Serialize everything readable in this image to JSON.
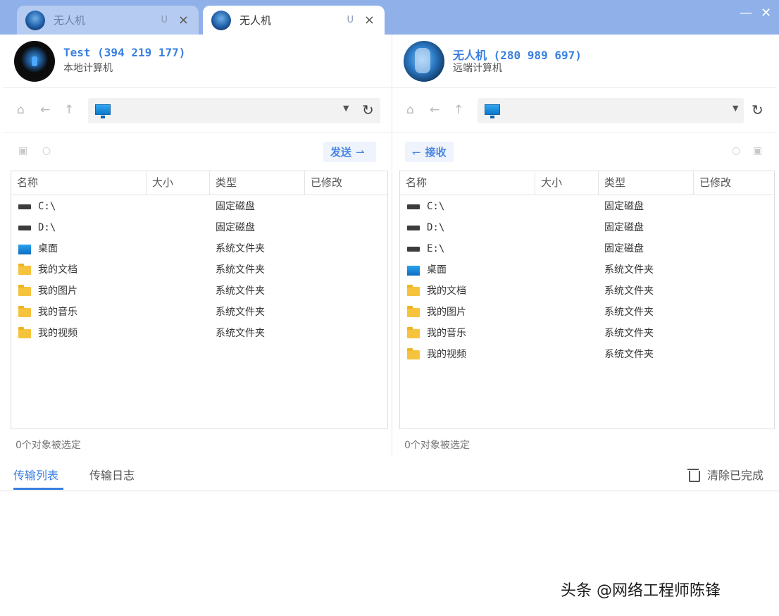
{
  "tabs": [
    {
      "title": "无人机",
      "badge": "U",
      "close": "×",
      "active": false
    },
    {
      "title": "无人机",
      "badge": "U",
      "close": "×",
      "active": true
    }
  ],
  "window": {
    "minimize": "—",
    "close": "✕"
  },
  "left": {
    "name": "Test (394 219 177)",
    "subtitle": "本地计算机",
    "send_label": "发送",
    "columns": [
      "名称",
      "大小",
      "类型",
      "已修改"
    ],
    "files": [
      {
        "name": "C:\\",
        "type": "固定磁盘",
        "icon": "drive-icon"
      },
      {
        "name": "D:\\",
        "type": "固定磁盘",
        "icon": "drive-icon"
      },
      {
        "name": "桌面",
        "type": "系统文件夹",
        "icon": "desktop-folder-icon"
      },
      {
        "name": "我的文档",
        "type": "系统文件夹",
        "icon": "folder-icon"
      },
      {
        "name": "我的图片",
        "type": "系统文件夹",
        "icon": "folder-icon"
      },
      {
        "name": "我的音乐",
        "type": "系统文件夹",
        "icon": "folder-icon"
      },
      {
        "name": "我的视频",
        "type": "系统文件夹",
        "icon": "folder-icon"
      }
    ],
    "status": "0个对象被选定"
  },
  "right": {
    "name": "无人机 (280 989 697)",
    "subtitle": "远端计算机",
    "receive_label": "接收",
    "columns": [
      "名称",
      "大小",
      "类型",
      "已修改"
    ],
    "files": [
      {
        "name": "C:\\",
        "type": "固定磁盘",
        "icon": "drive-icon"
      },
      {
        "name": "D:\\",
        "type": "固定磁盘",
        "icon": "drive-icon"
      },
      {
        "name": "E:\\",
        "type": "固定磁盘",
        "icon": "drive-icon"
      },
      {
        "name": "桌面",
        "type": "系统文件夹",
        "icon": "desktop-folder-icon"
      },
      {
        "name": "我的文档",
        "type": "系统文件夹",
        "icon": "folder-icon"
      },
      {
        "name": "我的图片",
        "type": "系统文件夹",
        "icon": "folder-icon"
      },
      {
        "name": "我的音乐",
        "type": "系统文件夹",
        "icon": "folder-icon"
      },
      {
        "name": "我的视频",
        "type": "系统文件夹",
        "icon": "folder-icon"
      }
    ],
    "status": "0个对象被选定"
  },
  "bottom": {
    "tab_list": "传输列表",
    "tab_log": "传输日志",
    "clear_label": "清除已完成"
  },
  "watermark": "头条 @网络工程师陈锋",
  "colors": {
    "accent": "#3a7fe0",
    "titlebar": "#8fb0e8"
  }
}
